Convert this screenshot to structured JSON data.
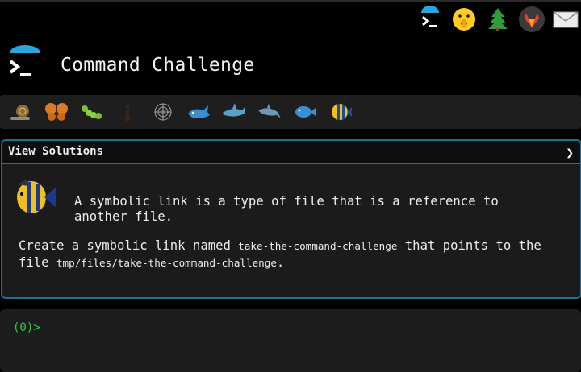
{
  "app": {
    "title": "Command Challenge"
  },
  "top_icons": [
    "terminal-icon",
    "shushing-face-icon",
    "tree-icon",
    "gitlab-icon",
    "mail-icon"
  ],
  "levels": [
    "snail-icon",
    "butterfly-icon",
    "caterpillar-icon",
    "ant-icon",
    "spider-web-icon",
    "whale-icon",
    "shark-icon",
    "dolphin-icon",
    "fish-icon",
    "tropical-fish-icon"
  ],
  "panel": {
    "header": "View Solutions",
    "chevron": "❯",
    "intro": "A symbolic link is a type of file that is a reference to another file.",
    "task_prefix": "Create a symbolic link named ",
    "task_name": "take-the-command-challenge",
    "task_mid": " that points to the file ",
    "task_target": "tmp/files/take-the-command-challenge",
    "task_end": "."
  },
  "terminal": {
    "prompt": "(0)>"
  },
  "colors": {
    "accent": "#1f6f8b",
    "prompt": "#2ecc40",
    "background": "#000000",
    "panel": "#1b1b1b"
  }
}
